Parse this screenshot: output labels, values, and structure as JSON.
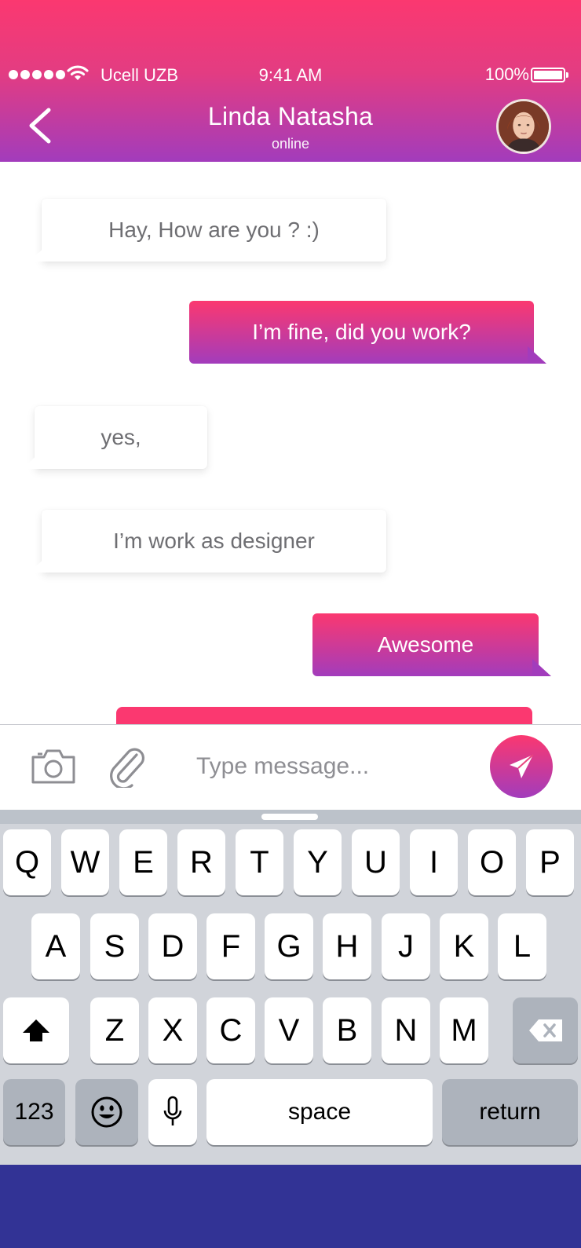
{
  "status_bar": {
    "carrier": "Ucell UZB",
    "time": "9:41 AM",
    "battery": "100%"
  },
  "header": {
    "contact_name": "Linda Natasha",
    "contact_status": "online"
  },
  "messages": [
    {
      "direction": "incoming",
      "text": "Hay, How are you ? :)"
    },
    {
      "direction": "outgoing",
      "text": "I’m fine, did you work?"
    },
    {
      "direction": "incoming",
      "text": "yes,"
    },
    {
      "direction": "incoming",
      "text": "I’m work as designer"
    },
    {
      "direction": "outgoing",
      "text": "Awesome"
    }
  ],
  "composer": {
    "placeholder": "Type message..."
  },
  "keyboard": {
    "row1": [
      "Q",
      "W",
      "E",
      "R",
      "T",
      "Y",
      "U",
      "I",
      "O",
      "P"
    ],
    "row2": [
      "A",
      "S",
      "D",
      "F",
      "G",
      "H",
      "J",
      "K",
      "L"
    ],
    "row3": [
      "Z",
      "X",
      "C",
      "V",
      "B",
      "N",
      "M"
    ],
    "numbers_key": "123",
    "space_key": "space",
    "return_key": "return"
  },
  "colors": {
    "gradient_top": "#fb3870",
    "gradient_bottom": "#a23cbc",
    "keyboard_bg": "#d1d4da",
    "bottom_bar": "#323395"
  }
}
